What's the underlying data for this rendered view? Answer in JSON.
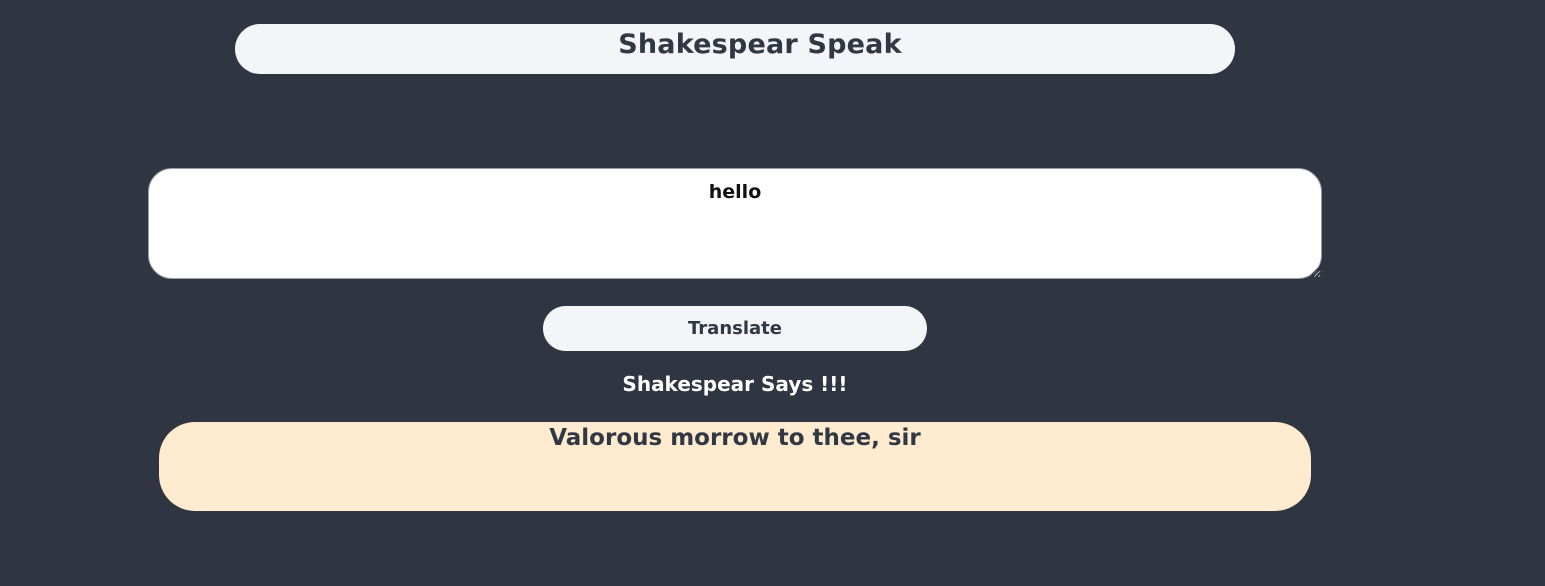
{
  "app": {
    "title": "Shakespear Speak"
  },
  "input": {
    "value": "hello"
  },
  "actions": {
    "translate_label": "Translate"
  },
  "output": {
    "label": "Shakespear Says !!!",
    "text": "Valorous morrow to thee, sir"
  },
  "colors": {
    "background": "#303641",
    "title_bar": "#f3f5f9",
    "button": "#f3f5f9",
    "output_box": "#ffebcf",
    "text_dark": "#313843"
  }
}
